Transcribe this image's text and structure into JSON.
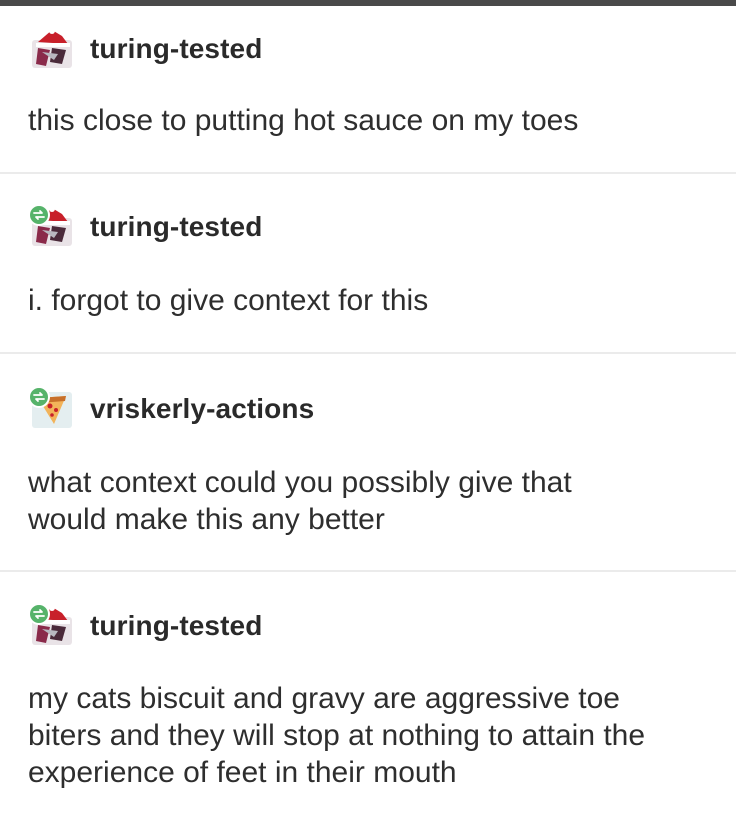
{
  "posts": [
    {
      "username": "turing-tested",
      "avatar_icon": "santa-hat-character-avatar-icon",
      "reblog": false,
      "lines": [
        "this close to putting hot sauce on my toes"
      ]
    },
    {
      "username": "turing-tested",
      "avatar_icon": "santa-hat-character-avatar-icon",
      "reblog": true,
      "lines": [
        "i. forgot to give context for this"
      ]
    },
    {
      "username": "vriskerly-actions",
      "avatar_icon": "pizza-slice-avatar-icon",
      "reblog": true,
      "lines": [
        "what context could you possibly give that",
        "would make this any better"
      ]
    },
    {
      "username": "turing-tested",
      "avatar_icon": "santa-hat-character-avatar-icon",
      "reblog": true,
      "lines": [
        "my cats biscuit and gravy are aggressive toe",
        "biters and they will stop at nothing to attain the",
        "experience of feet in their mouth"
      ]
    }
  ],
  "colors": {
    "reblog_badge": "#56b36a",
    "divider": "#ebebeb",
    "text": "#2e2e2e"
  }
}
